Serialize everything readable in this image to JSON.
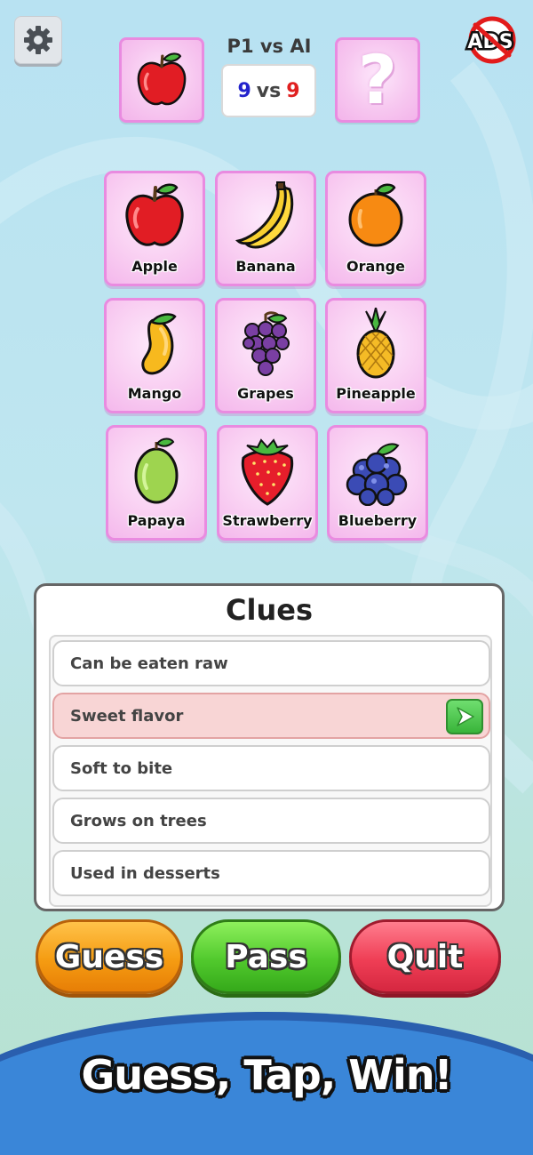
{
  "header": {
    "match_title": "P1 vs AI",
    "score_p1": "9",
    "score_vs": "vs",
    "score_ai": "9",
    "left_slot_icon": "apple-icon",
    "right_slot_icon": "question-mark-icon",
    "right_slot_text": "?",
    "settings_icon": "gear-icon",
    "ads_badge_text": "ADS"
  },
  "fruits": [
    {
      "label": "Apple",
      "icon": "apple-icon"
    },
    {
      "label": "Banana",
      "icon": "banana-icon"
    },
    {
      "label": "Orange",
      "icon": "orange-icon"
    },
    {
      "label": "Mango",
      "icon": "mango-icon"
    },
    {
      "label": "Grapes",
      "icon": "grapes-icon"
    },
    {
      "label": "Pineapple",
      "icon": "pineapple-icon"
    },
    {
      "label": "Papaya",
      "icon": "papaya-icon"
    },
    {
      "label": "Strawberry",
      "icon": "strawberry-icon"
    },
    {
      "label": "Blueberry",
      "icon": "blueberry-icon"
    }
  ],
  "clues": {
    "title": "Clues",
    "items": [
      {
        "text": "Can be eaten raw",
        "active": false
      },
      {
        "text": "Sweet flavor",
        "active": true
      },
      {
        "text": "Soft to bite",
        "active": false
      },
      {
        "text": "Grows on trees",
        "active": false
      },
      {
        "text": "Used in desserts",
        "active": false
      }
    ]
  },
  "actions": {
    "guess_label": "Guess",
    "pass_label": "Pass",
    "quit_label": "Quit"
  },
  "banner": {
    "text": "Guess, Tap, Win!"
  },
  "colors": {
    "card_pink": "#f7c8f0",
    "card_border": "#e98be0",
    "guess": "#f59c12",
    "pass": "#51c92d",
    "quit": "#ef3e55",
    "banner_blue": "#3a86d8"
  }
}
